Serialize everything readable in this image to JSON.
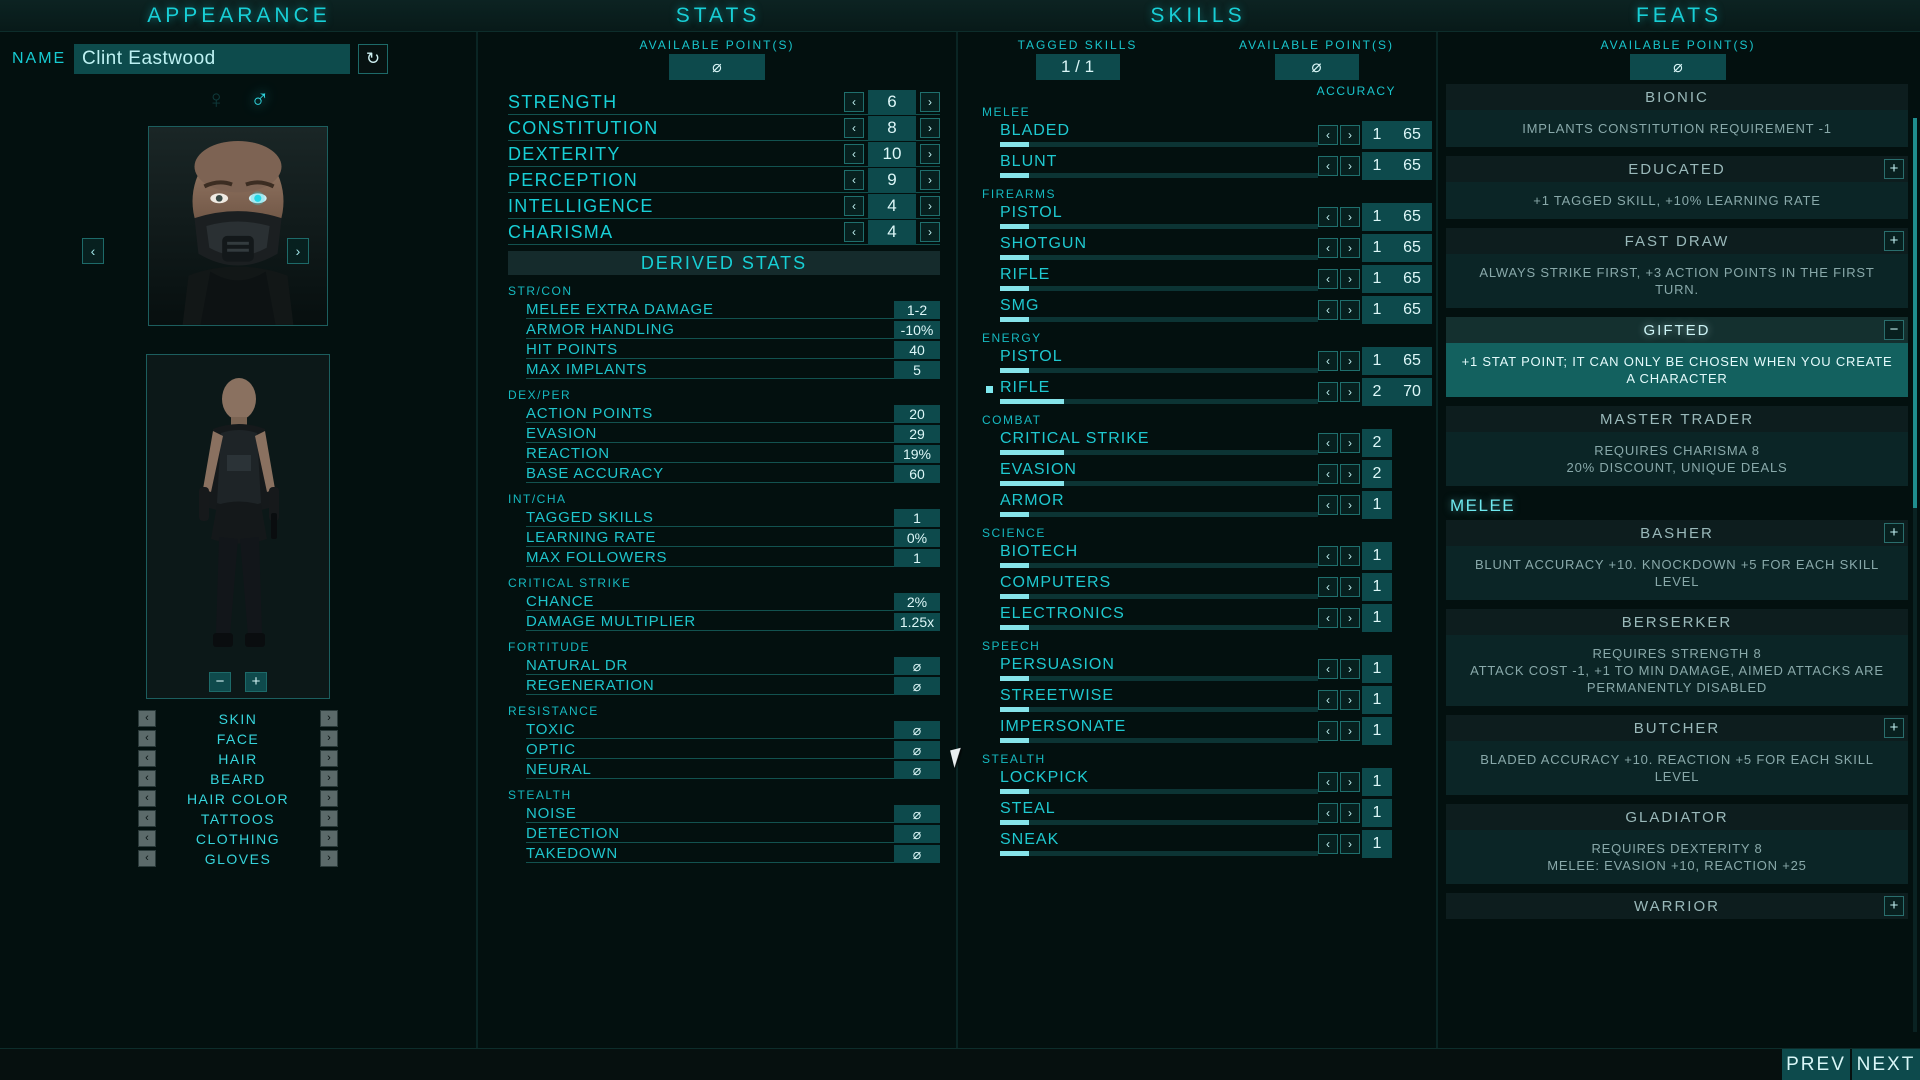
{
  "header": {
    "appearance": "APPEARANCE",
    "stats": "STATS",
    "skills": "SKILLS",
    "feats": "FEATS"
  },
  "appearance": {
    "name_label": "NAME",
    "name_value": "Clint Eastwood",
    "randomize_icon": "↻",
    "gender_female_icon": "♀",
    "gender_male_icon": "♂",
    "prev_portrait": "‹",
    "next_portrait": "›",
    "zoom_out": "−",
    "zoom_in": "+",
    "options": [
      {
        "label": "SKIN"
      },
      {
        "label": "FACE"
      },
      {
        "label": "HAIR"
      },
      {
        "label": "BEARD"
      },
      {
        "label": "HAIR COLOR"
      },
      {
        "label": "TATTOOS"
      },
      {
        "label": "CLOTHING"
      },
      {
        "label": "GLOVES"
      }
    ],
    "opt_prev": "‹",
    "opt_next": "›"
  },
  "stats": {
    "points_title": "AVAILABLE POINT(S)",
    "points_value": "⌀",
    "dec": "‹",
    "inc": "›",
    "primary": [
      {
        "name": "STRENGTH",
        "value": "6"
      },
      {
        "name": "CONSTITUTION",
        "value": "8"
      },
      {
        "name": "DEXTERITY",
        "value": "10"
      },
      {
        "name": "PERCEPTION",
        "value": "9"
      },
      {
        "name": "INTELLIGENCE",
        "value": "4"
      },
      {
        "name": "CHARISMA",
        "value": "4"
      }
    ],
    "derived_title": "DERIVED STATS",
    "derived_groups": [
      {
        "group": "STR/CON",
        "rows": [
          {
            "name": "MELEE EXTRA DAMAGE",
            "value": "1-2"
          },
          {
            "name": "ARMOR HANDLING",
            "value": "-10%"
          },
          {
            "name": "HIT POINTS",
            "value": "40"
          },
          {
            "name": "MAX IMPLANTS",
            "value": "5"
          }
        ]
      },
      {
        "group": "DEX/PER",
        "rows": [
          {
            "name": "ACTION POINTS",
            "value": "20"
          },
          {
            "name": "EVASION",
            "value": "29"
          },
          {
            "name": "REACTION",
            "value": "19%"
          },
          {
            "name": "BASE ACCURACY",
            "value": "60"
          }
        ]
      },
      {
        "group": "INT/CHA",
        "rows": [
          {
            "name": "TAGGED SKILLS",
            "value": "1"
          },
          {
            "name": "LEARNING RATE",
            "value": "0%"
          },
          {
            "name": "MAX FOLLOWERS",
            "value": "1"
          }
        ]
      },
      {
        "group": "CRITICAL STRIKE",
        "rows": [
          {
            "name": "CHANCE",
            "value": "2%"
          },
          {
            "name": "DAMAGE MULTIPLIER",
            "value": "1.25x"
          }
        ]
      },
      {
        "group": "FORTITUDE",
        "rows": [
          {
            "name": "NATURAL DR",
            "value": "⌀"
          },
          {
            "name": "REGENERATION",
            "value": "⌀"
          }
        ]
      },
      {
        "group": "RESISTANCE",
        "rows": [
          {
            "name": "TOXIC",
            "value": "⌀"
          },
          {
            "name": "OPTIC",
            "value": "⌀"
          },
          {
            "name": "NEURAL",
            "value": "⌀"
          }
        ]
      },
      {
        "group": "STEALTH",
        "rows": [
          {
            "name": "NOISE",
            "value": "⌀"
          },
          {
            "name": "DETECTION",
            "value": "⌀"
          },
          {
            "name": "TAKEDOWN",
            "value": "⌀"
          }
        ]
      }
    ]
  },
  "skills": {
    "tagged_title": "TAGGED SKILLS",
    "tagged_value": "1 / 1",
    "points_title": "AVAILABLE POINT(S)",
    "points_value": "⌀",
    "accuracy_label": "ACCURACY",
    "dec": "‹",
    "inc": "›",
    "groups": [
      {
        "group": "MELEE",
        "rows": [
          {
            "name": "BLADED",
            "value": "1",
            "accuracy": "65",
            "fill": 9,
            "tagged": false
          },
          {
            "name": "BLUNT",
            "value": "1",
            "accuracy": "65",
            "fill": 9,
            "tagged": false
          }
        ]
      },
      {
        "group": "FIREARMS",
        "rows": [
          {
            "name": "PISTOL",
            "value": "1",
            "accuracy": "65",
            "fill": 9,
            "tagged": false
          },
          {
            "name": "SHOTGUN",
            "value": "1",
            "accuracy": "65",
            "fill": 9,
            "tagged": false
          },
          {
            "name": "RIFLE",
            "value": "1",
            "accuracy": "65",
            "fill": 9,
            "tagged": false
          },
          {
            "name": "SMG",
            "value": "1",
            "accuracy": "65",
            "fill": 9,
            "tagged": false
          }
        ]
      },
      {
        "group": "ENERGY",
        "rows": [
          {
            "name": "PISTOL",
            "value": "1",
            "accuracy": "65",
            "fill": 9,
            "tagged": false
          },
          {
            "name": "RIFLE",
            "value": "2",
            "accuracy": "70",
            "fill": 20,
            "tagged": true
          }
        ]
      },
      {
        "group": "COMBAT",
        "rows": [
          {
            "name": "CRITICAL STRIKE",
            "value": "2",
            "accuracy": "",
            "fill": 20,
            "tagged": false
          },
          {
            "name": "EVASION",
            "value": "2",
            "accuracy": "",
            "fill": 20,
            "tagged": false
          },
          {
            "name": "ARMOR",
            "value": "1",
            "accuracy": "",
            "fill": 9,
            "tagged": false
          }
        ]
      },
      {
        "group": "SCIENCE",
        "rows": [
          {
            "name": "BIOTECH",
            "value": "1",
            "accuracy": "",
            "fill": 9,
            "tagged": false
          },
          {
            "name": "COMPUTERS",
            "value": "1",
            "accuracy": "",
            "fill": 9,
            "tagged": false
          },
          {
            "name": "ELECTRONICS",
            "value": "1",
            "accuracy": "",
            "fill": 9,
            "tagged": false
          }
        ]
      },
      {
        "group": "SPEECH",
        "rows": [
          {
            "name": "PERSUASION",
            "value": "1",
            "accuracy": "",
            "fill": 9,
            "tagged": false
          },
          {
            "name": "STREETWISE",
            "value": "1",
            "accuracy": "",
            "fill": 9,
            "tagged": false
          },
          {
            "name": "IMPERSONATE",
            "value": "1",
            "accuracy": "",
            "fill": 9,
            "tagged": false
          }
        ]
      },
      {
        "group": "STEALTH",
        "rows": [
          {
            "name": "LOCKPICK",
            "value": "1",
            "accuracy": "",
            "fill": 9,
            "tagged": false
          },
          {
            "name": "STEAL",
            "value": "1",
            "accuracy": "",
            "fill": 9,
            "tagged": false
          },
          {
            "name": "SNEAK",
            "value": "1",
            "accuracy": "",
            "fill": 9,
            "tagged": false
          }
        ]
      }
    ]
  },
  "feats": {
    "points_title": "AVAILABLE POINT(S)",
    "points_value": "⌀",
    "add_icon": "+",
    "remove_icon": "−",
    "items": [
      {
        "kind": "feat",
        "title": "BIONIC",
        "desc": "IMPLANTS CONSTITUTION REQUIREMENT -1",
        "selected": false,
        "button": ""
      },
      {
        "kind": "feat",
        "title": "EDUCATED",
        "desc": "+1 TAGGED SKILL, +10% LEARNING RATE",
        "selected": false,
        "button": "+"
      },
      {
        "kind": "feat",
        "title": "FAST DRAW",
        "desc": "ALWAYS STRIKE FIRST, +3 ACTION POINTS IN THE FIRST TURN.",
        "selected": false,
        "button": "+"
      },
      {
        "kind": "feat",
        "title": "GIFTED",
        "desc": "+1 STAT POINT; IT CAN ONLY BE CHOSEN WHEN YOU CREATE A CHARACTER",
        "selected": true,
        "button": "−"
      },
      {
        "kind": "feat",
        "title": "MASTER TRADER",
        "desc": "REQUIRES CHARISMA 8\n20% DISCOUNT, UNIQUE DEALS",
        "selected": false,
        "button": ""
      },
      {
        "kind": "category",
        "title": "MELEE"
      },
      {
        "kind": "feat",
        "title": "BASHER",
        "desc": "BLUNT ACCURACY +10. KNOCKDOWN +5 FOR EACH SKILL LEVEL",
        "selected": false,
        "button": "+"
      },
      {
        "kind": "feat",
        "title": "BERSERKER",
        "desc": "REQUIRES STRENGTH 8\nATTACK COST -1, +1 TO MIN DAMAGE, AIMED ATTACKS ARE PERMANENTLY DISABLED",
        "selected": false,
        "button": ""
      },
      {
        "kind": "feat",
        "title": "BUTCHER",
        "desc": "BLADED ACCURACY +10. REACTION +5 FOR EACH SKILL LEVEL",
        "selected": false,
        "button": "+"
      },
      {
        "kind": "feat",
        "title": "GLADIATOR",
        "desc": "REQUIRES DEXTERITY 8\nMELEE: EVASION +10, REACTION +25",
        "selected": false,
        "button": ""
      },
      {
        "kind": "feat",
        "title": "WARRIOR",
        "desc": "",
        "selected": false,
        "button": "+"
      }
    ]
  },
  "bottom": {
    "prev": "PREV",
    "next": "NEXT"
  }
}
